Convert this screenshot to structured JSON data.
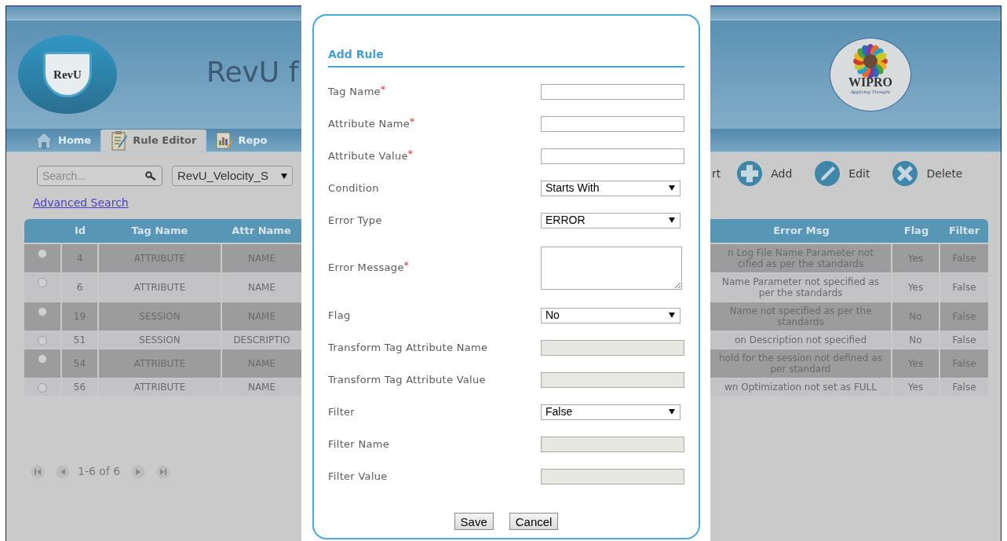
{
  "header": {
    "left_logo": "RevU",
    "title": "RevU f",
    "right_logo": {
      "name": "WIPRO",
      "tagline": "Applying Thought"
    }
  },
  "tabs": [
    {
      "label": "Home",
      "selected": false
    },
    {
      "label": "Rule Editor",
      "selected": true
    },
    {
      "label": "Repo",
      "selected": false
    }
  ],
  "search": {
    "placeholder": "Search..."
  },
  "ruleset_select": {
    "value": "RevU_Velocity_S"
  },
  "advanced_search": "Advanced Search",
  "toolbar": [
    "rt",
    "Add",
    "Edit",
    "Delete"
  ],
  "table": {
    "left_columns": [
      "Id",
      "Tag Name",
      "Attr Name"
    ],
    "right_columns": [
      "Error Msg",
      "Flag",
      "Filter"
    ],
    "rows": [
      {
        "selected": false,
        "id": "4",
        "tag_name": "ATTRIBUTE",
        "attr_name": "NAME",
        "error_msg_lines": [
          "n Log File Name Parameter not",
          "cified as per the standards"
        ],
        "flag": "Yes",
        "filter": "False"
      },
      {
        "selected": false,
        "id": "6",
        "tag_name": "ATTRIBUTE",
        "attr_name": "NAME",
        "error_msg_lines": [
          "Name Parameter not specified as",
          "per the standards"
        ],
        "flag": "Yes",
        "filter": "False"
      },
      {
        "selected": false,
        "id": "19",
        "tag_name": "SESSION",
        "attr_name": "NAME",
        "error_msg_lines": [
          "Name not specified as per the",
          "standards"
        ],
        "flag": "No",
        "filter": "False"
      },
      {
        "selected": false,
        "id": "51",
        "tag_name": "SESSION",
        "attr_name": "DESCRIPTIO",
        "error_msg_lines": [
          "on Description not specified"
        ],
        "flag": "No",
        "filter": "False"
      },
      {
        "selected": false,
        "id": "54",
        "tag_name": "ATTRIBUTE",
        "attr_name": "NAME",
        "error_msg_lines": [
          "hold for the session not defined as",
          "per standard"
        ],
        "flag": "Yes",
        "filter": "False"
      },
      {
        "selected": false,
        "id": "56",
        "tag_name": "ATTRIBUTE",
        "attr_name": "NAME",
        "error_msg_lines": [
          "wn Optimization not set as FULL"
        ],
        "flag": "Yes",
        "filter": "False"
      }
    ]
  },
  "pagination": {
    "text": "1-6 of 6"
  },
  "dialog": {
    "title": "Add Rule",
    "required_mark": "*",
    "fields": [
      {
        "label": "Tag Name",
        "kind": "text",
        "required": true,
        "disabled": false
      },
      {
        "label": "Attribute Name",
        "kind": "text",
        "required": true,
        "disabled": false
      },
      {
        "label": "Attribute Value",
        "kind": "text",
        "required": true,
        "disabled": false
      },
      {
        "label": "Condition",
        "kind": "select",
        "required": false,
        "disabled": false,
        "value": "Starts With"
      },
      {
        "label": "Error Type",
        "kind": "select",
        "required": false,
        "disabled": false,
        "value": "ERROR"
      },
      {
        "label": "Error Message",
        "kind": "textarea",
        "required": true,
        "disabled": false
      },
      {
        "label": "Flag",
        "kind": "select",
        "required": false,
        "disabled": false,
        "value": "No"
      },
      {
        "label": "Transform Tag Attribute Name",
        "kind": "text",
        "required": false,
        "disabled": true
      },
      {
        "label": "Transform Tag Attribute Value",
        "kind": "text",
        "required": false,
        "disabled": true
      },
      {
        "label": "Filter",
        "kind": "select",
        "required": false,
        "disabled": false,
        "value": "False"
      },
      {
        "label": "Filter Name",
        "kind": "text",
        "required": false,
        "disabled": true
      },
      {
        "label": "Filter Value",
        "kind": "text",
        "required": false,
        "disabled": true
      }
    ],
    "buttons": [
      "Save",
      "Cancel"
    ]
  }
}
